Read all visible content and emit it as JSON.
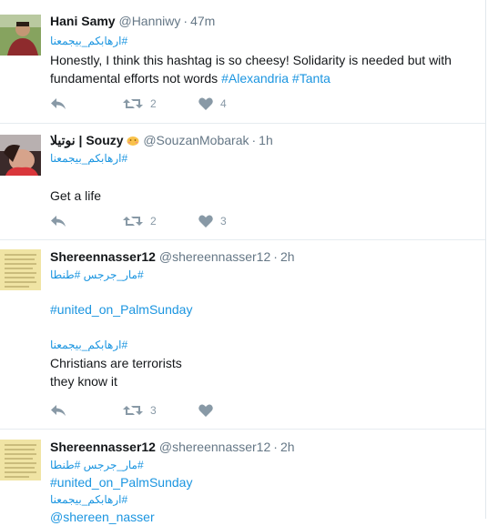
{
  "tweets": [
    {
      "name": "Hani Samy",
      "handle": "@Hanniwy",
      "time": "47m",
      "arabic_tag": "#ارهابكم_بيجمعنا",
      "text_a": "Honestly, I think this hashtag is so cheesy! Solidarity is needed but with",
      "text_b": "fundamental efforts not words",
      "tag1": "#Alexandria",
      "tag2": "#Tanta",
      "retweets": "2",
      "likes": "4"
    },
    {
      "name_arabic": "نوتيلا",
      "name_sep": "|",
      "name": "Souzy",
      "handle": "@SouzanMobarak",
      "time": "1h",
      "arabic_tag": "#ارهابكم_بيجمعنا",
      "text": "Get a life",
      "retweets": "2",
      "likes": "3"
    },
    {
      "name": "Shereennasser12",
      "handle": "@shereennasser12",
      "time": "2h",
      "arabic_tags": "#مار_جرجس #طنطا",
      "tag_line": "#united_on_PalmSunday",
      "arabic_tag": "#ارهابكم_بيجمعنا",
      "text_a": "Christians are terrorists",
      "text_b": "they know it",
      "retweets": "3"
    },
    {
      "name": "Shereennasser12",
      "handle": "@shereennasser12",
      "time": "2h",
      "arabic_tags": "#مار_جرجس #طنطا",
      "tag_line": "#united_on_PalmSunday",
      "arabic_tag": "#ارهابكم_بيجمعنا",
      "cut_text": "@shereen_nasser"
    }
  ],
  "colors": {
    "link": "#1b95e0",
    "muted": "#657786",
    "icon": "#8899a6",
    "divider": "#e6ecf0"
  },
  "icons": [
    "reply-icon",
    "retweet-icon",
    "heart-icon"
  ]
}
